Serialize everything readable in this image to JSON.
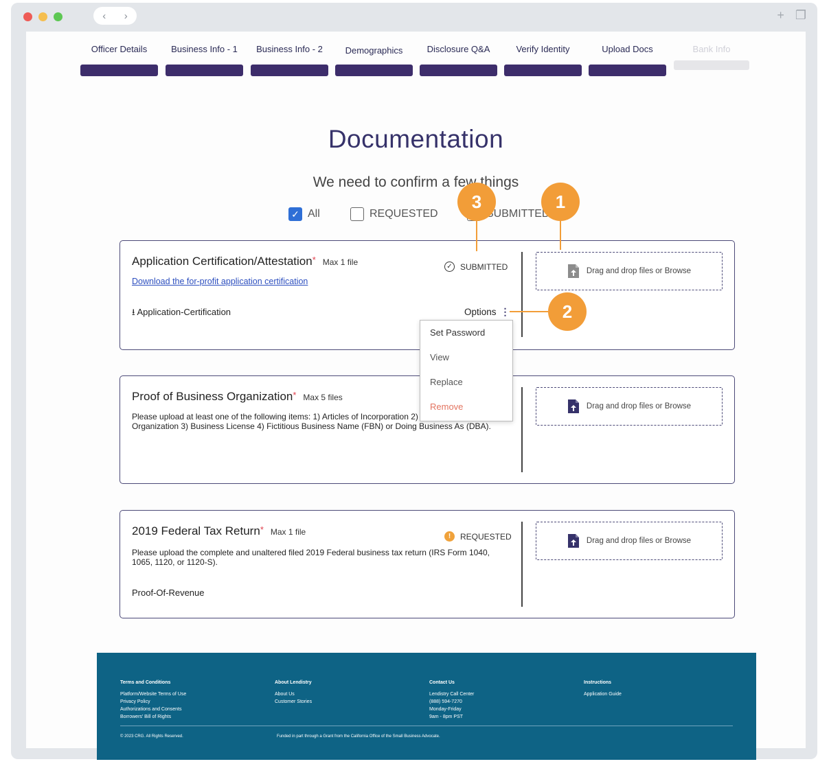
{
  "window": {
    "nav_back": "‹",
    "nav_forward": "›",
    "new_tab": "+",
    "window_icon": "❐"
  },
  "stepper": [
    {
      "label": "Officer Details",
      "state": "complete"
    },
    {
      "label": "Business Info - 1",
      "state": "complete"
    },
    {
      "label": "Business Info - 2",
      "state": "complete"
    },
    {
      "label": "Demographics",
      "state": "complete"
    },
    {
      "label": "Disclosure Q&A",
      "state": "complete"
    },
    {
      "label": "Verify Identity",
      "state": "complete"
    },
    {
      "label": "Upload Docs",
      "state": "complete"
    },
    {
      "label": "Bank Info",
      "state": "inactive"
    }
  ],
  "page": {
    "title": "Documentation",
    "subtitle": "We need to confirm a few things"
  },
  "filters": {
    "all": {
      "label": "All",
      "checked": true
    },
    "requested": {
      "label": "REQUESTED",
      "checked": false
    },
    "submitted": {
      "label": "SUBMITTED",
      "checked": false
    }
  },
  "cards": [
    {
      "title": "Application Certification/Attestation",
      "required_mark": "*",
      "max_files": "Max 1 file",
      "status": "SUBMITTED",
      "link": "Download the for-profit application certification",
      "file": "Application-Certification",
      "options_label": "Options",
      "dropzone": "Drag and drop files or Browse"
    },
    {
      "title": "Proof of Business Organization",
      "required_mark": "*",
      "max_files": "Max 5 files",
      "description": "Please upload at least one of the following items: 1) Articles of Incorporation 2) Articles of Organization 3) Business License 4) Fictitious Business Name (FBN) or Doing Business As (DBA).",
      "dropzone": "Drag and drop files or Browse"
    },
    {
      "title": "2019 Federal Tax Return",
      "required_mark": "*",
      "max_files": "Max 1 file",
      "status": "REQUESTED",
      "description": "Please upload the complete and unaltered filed 2019 Federal business tax return (IRS Form 1040, 1065, 1120, or 1120-S).",
      "file": "Proof-Of-Revenue",
      "dropzone": "Drag and drop files or Browse"
    }
  ],
  "options_menu": [
    "Set Password",
    "View",
    "Replace",
    "Remove"
  ],
  "callouts": [
    "1",
    "2",
    "3"
  ],
  "footer": {
    "col1": {
      "heading": "Terms and Conditions",
      "items": [
        "Platform/Website Terms of Use",
        "Privacy Policy",
        "Authorizations and Consents",
        "Borrowers' Bill of Rights"
      ]
    },
    "col2": {
      "heading": "About Lendistry",
      "items": [
        "About Us",
        "Customer Stories"
      ]
    },
    "col3": {
      "heading": "Contact Us",
      "items": [
        "Lendistry Call Center",
        "(888) 594-7270",
        "Monday-Friday",
        "9am - 8pm PST"
      ]
    },
    "col4": {
      "heading": "Instructions",
      "items": [
        "Application Guide"
      ]
    },
    "copyright": "© 2023 CRG. All Rights Reserved.",
    "funding": "Funded in part through a Grant from the California Office of the Small Business Advocate."
  }
}
